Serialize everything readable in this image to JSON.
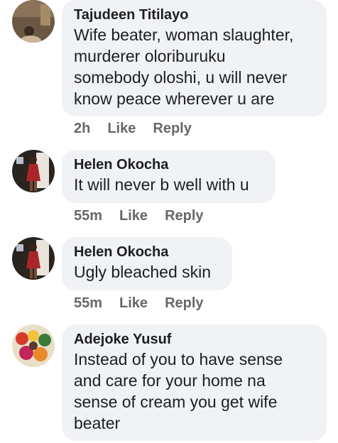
{
  "comments": [
    {
      "author": "Tajudeen Titilayo",
      "lines": [
        "Wife beater, woman slaughter,",
        "murderer oloriburuku",
        "somebody oloshi, u will never",
        "know peace wherever u are"
      ],
      "time": "2h",
      "like_label": "Like",
      "reply_label": "Reply",
      "avatar_icon": "user-photo-icon"
    },
    {
      "author": "Helen Okocha",
      "lines": [
        "It will never b well with u"
      ],
      "time": "55m",
      "like_label": "Like",
      "reply_label": "Reply",
      "avatar_icon": "user-photo-icon"
    },
    {
      "author": "Helen Okocha",
      "lines": [
        "Ugly bleached skin"
      ],
      "time": "55m",
      "like_label": "Like",
      "reply_label": "Reply",
      "avatar_icon": "user-photo-icon"
    },
    {
      "author": "Adejoke Yusuf",
      "lines": [
        "Instead of you to have sense",
        "and care for your home na",
        "sense of cream you get wife",
        "beater"
      ],
      "time": "",
      "like_label": "",
      "reply_label": "",
      "avatar_icon": "user-photo-icon"
    }
  ],
  "colors": {
    "bubble": "#f0f2f5",
    "name": "#1c1e21",
    "meta": "#65676b"
  }
}
